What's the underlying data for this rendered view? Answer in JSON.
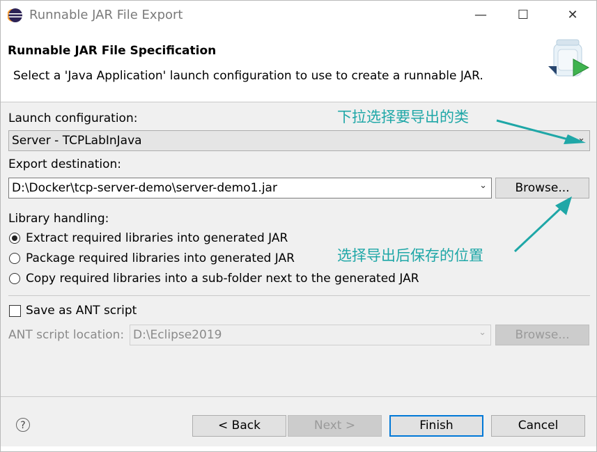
{
  "window": {
    "title": "Runnable JAR File Export",
    "minimize_glyph": "—",
    "maximize_glyph": "☐",
    "close_glyph": "✕"
  },
  "header": {
    "title": "Runnable JAR File Specification",
    "description": "Select a 'Java Application' launch configuration to use to create a runnable JAR."
  },
  "launch": {
    "label": "Launch configuration:",
    "value": "Server - TCPLabInJava"
  },
  "export": {
    "label": "Export destination:",
    "value": "D:\\Docker\\tcp-server-demo\\server-demo1.jar",
    "browse_label": "Browse..."
  },
  "library": {
    "label": "Library handling:",
    "options": [
      {
        "label": "Extract required libraries into generated JAR",
        "selected": true
      },
      {
        "label": "Package required libraries into generated JAR",
        "selected": false
      },
      {
        "label": "Copy required libraries into a sub-folder next to the generated JAR",
        "selected": false
      }
    ]
  },
  "ant": {
    "save_label": "Save as ANT script",
    "checked": false,
    "location_label": "ANT script location:",
    "location_value": "D:\\Eclipse2019",
    "browse_label": "Browse..."
  },
  "annotations": {
    "top": "下拉选择要导出的类",
    "bottom": "选择导出后保存的位置",
    "color": "#1fa7a7"
  },
  "footer": {
    "help_glyph": "?",
    "back_label": "< Back",
    "next_label": "Next >",
    "finish_label": "Finish",
    "cancel_label": "Cancel"
  }
}
